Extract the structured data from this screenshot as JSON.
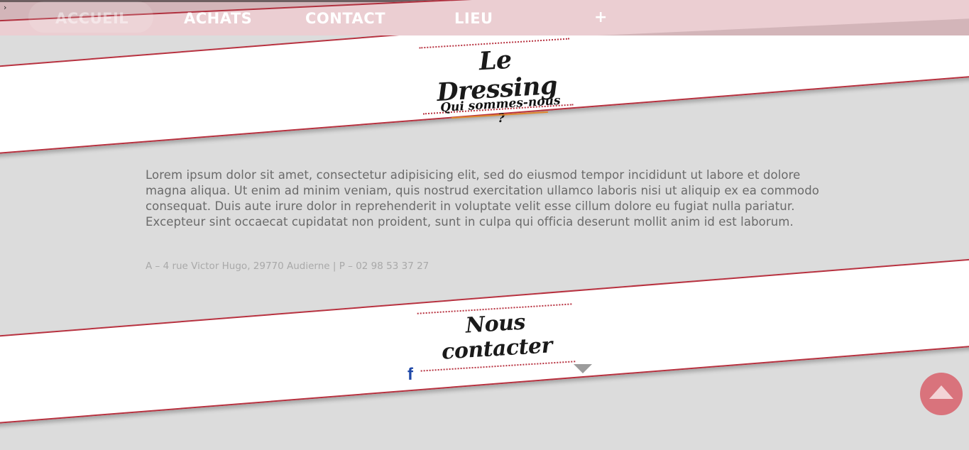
{
  "nav": {
    "arrow": "›",
    "items": [
      {
        "label": "ACCUEIL",
        "active": true
      },
      {
        "label": "ACHATS",
        "active": false
      },
      {
        "label": "CONTACT",
        "active": false
      },
      {
        "label": "LIEU",
        "active": false
      },
      {
        "label": "+",
        "active": false
      }
    ]
  },
  "header": {
    "title": "Le Dressing",
    "subtitle": "Qui sommes-nous ?"
  },
  "about": {
    "text": "Lorem ipsum dolor sit amet, consectetur adipisicing elit, sed do eiusmod tempor incididunt ut labore et dolore magna aliqua. Ut enim ad minim veniam, quis nostrud exercitation ullamco laboris nisi ut aliquip ex ea commodo consequat. Duis aute irure dolor in reprehenderit in voluptate velit esse cillum dolore eu fugiat nulla pariatur. Excepteur sint occaecat cupidatat non proident, sunt in culpa qui officia deserunt mollit anim id est laborum.",
    "address": "A – 4 rue Victor Hugo, 29770 Audierne | P – 02 98 53 37 27"
  },
  "contact": {
    "title": "Nous contacter",
    "facebook_glyph": "f"
  },
  "icons": {
    "facebook": "facebook-icon",
    "dropdown": "caret-down-icon",
    "back_to_top": "arrow-up-icon"
  },
  "colors": {
    "accent": "#b7313f",
    "nav_bg": "#d3b5b9",
    "page_bg": "#dcdcdc",
    "underline": "#e0872d",
    "back_to_top": "#d9737c",
    "facebook": "#1f48a8"
  }
}
